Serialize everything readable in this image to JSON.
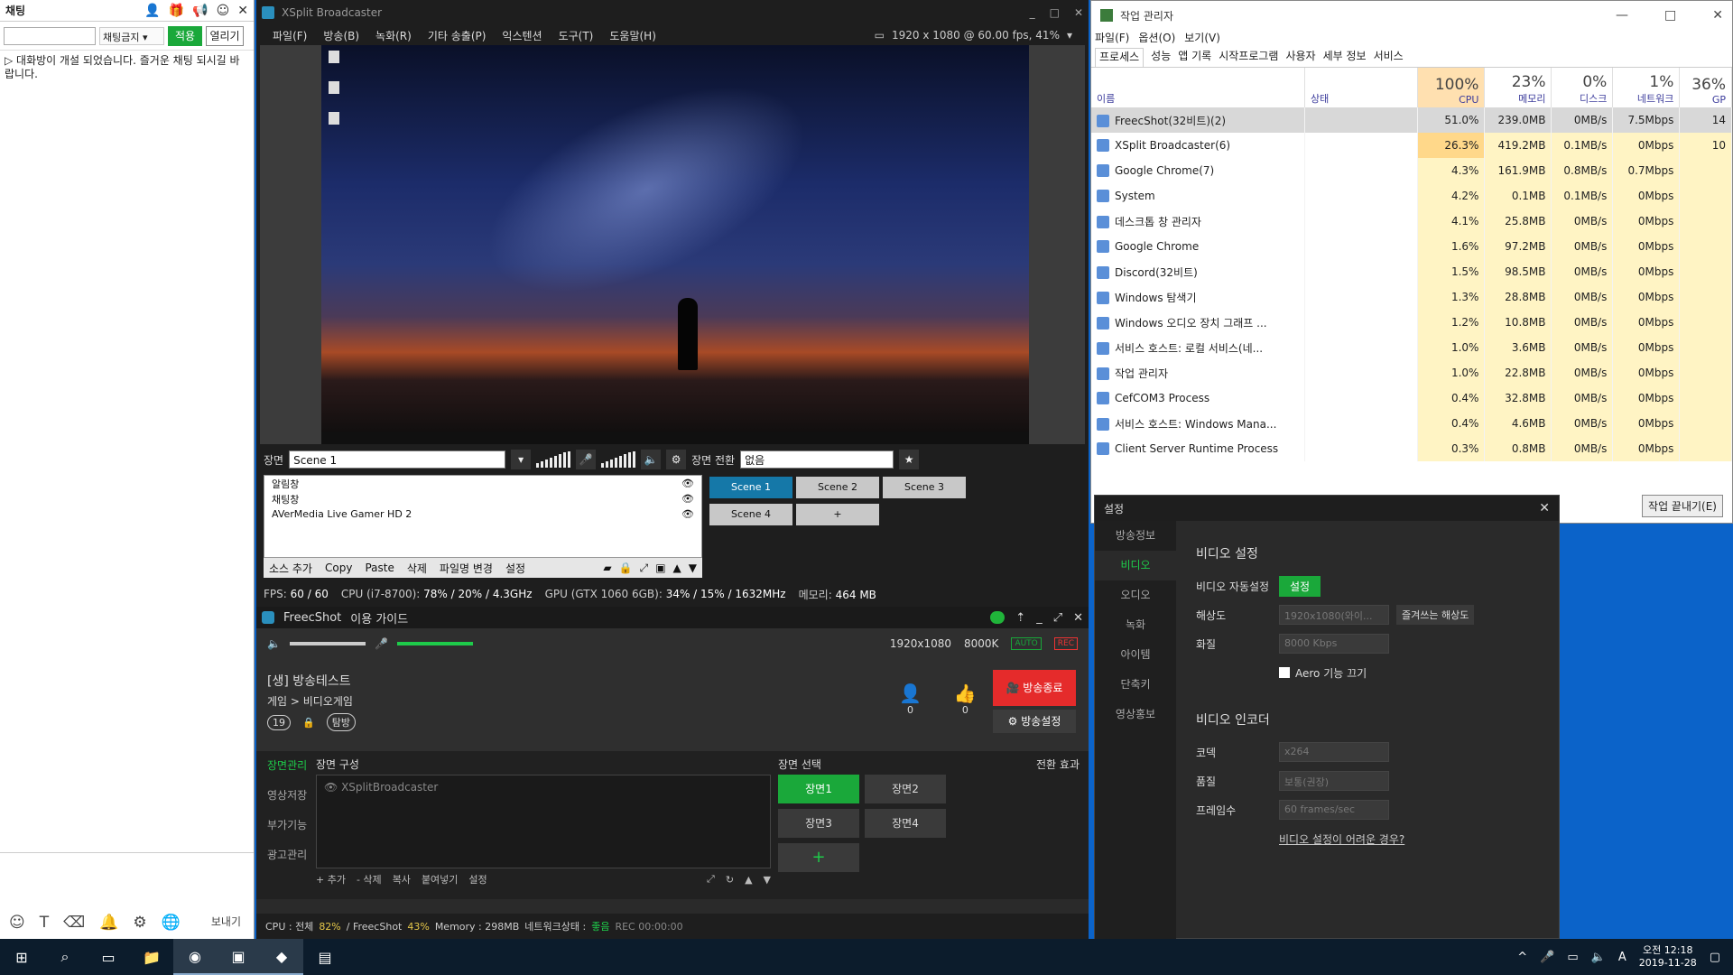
{
  "chat": {
    "title": "채팅",
    "filter_select": "채팅금지",
    "apply_label": "적용",
    "open_label": "열리기",
    "message": "▷ 대화방이 개설 되었습니다. 즐거운 채팅 되시길 바랍니다.",
    "send_label": "보내기"
  },
  "xsplit": {
    "title": "XSplit Broadcaster",
    "menu": [
      "파일(F)",
      "방송(B)",
      "녹화(R)",
      "기타 송출(P)",
      "익스텐션",
      "도구(T)",
      "도움말(H)"
    ],
    "resolution": "1920 x 1080 @ 60.00 fps, 41%",
    "scene_label": "장면",
    "scene_name": "Scene 1",
    "transition_label": "장면 전환",
    "transition_value": "없음",
    "sources": [
      "알림창",
      "채팅창",
      "AVerMedia Live Gamer HD 2"
    ],
    "source_actions": [
      "소스 추가",
      "Copy",
      "Paste",
      "삭제",
      "파일명 변경",
      "설정"
    ],
    "scenes": [
      "Scene 1",
      "Scene 2",
      "Scene 3",
      "Scene 4",
      "+"
    ],
    "status": {
      "fps_label": "FPS:",
      "fps": "60 / 60",
      "cpu_label": "CPU (i7-8700):",
      "cpu": "78% / 20% / 4.3GHz",
      "gpu_label": "GPU (GTX 1060 6GB):",
      "gpu": "34% / 15% / 1632MHz",
      "mem_label": "메모리:",
      "mem": "464 MB"
    }
  },
  "freecshot": {
    "title": "FreecShot",
    "guide": "이용 가이드",
    "resolution": "1920x1080",
    "bitrate": "8000K",
    "auto": "AUTO",
    "rec": "REC",
    "broadcast_title": "[생] 방송테스트",
    "category": "게임 > 비디오게임",
    "age_badge": "19",
    "tag": "탐방",
    "viewers": "0",
    "likes": "0",
    "end_label": "방송종료",
    "settings_label": "방송설정",
    "side": [
      "장면관리",
      "영상저장",
      "부가기능",
      "광고관리"
    ],
    "compose_title": "장면 구성",
    "compose_item": "XSplitBroadcaster",
    "compose_actions": [
      "+ 추가",
      "- 삭제",
      "복사",
      "붙여넣기",
      "설정"
    ],
    "pick_title": "장면 선택",
    "transition": "전환 효과",
    "scenes": [
      "장면1",
      "장면2",
      "장면3",
      "장면4"
    ],
    "status": {
      "cpu_label": "CPU : 전체",
      "cpu_total": "82%",
      "freecshot_label": "/ FreecShot",
      "freecshot_cpu": "43%",
      "memory": "Memory : 298MB",
      "net_label": "네트워크상태 :",
      "net": "좋음",
      "rec": "REC 00:00:00"
    }
  },
  "taskmgr": {
    "title": "작업 관리자",
    "menu": [
      "파일(F)",
      "옵션(O)",
      "보기(V)"
    ],
    "tabs": [
      "프로세스",
      "성능",
      "앱 기록",
      "시작프로그램",
      "사용자",
      "세부 정보",
      "서비스"
    ],
    "headers": {
      "name": "이름",
      "status": "상태",
      "cpu_pct": "100%",
      "cpu": "CPU",
      "mem_pct": "23%",
      "mem": "메모리",
      "disk_pct": "0%",
      "disk": "디스크",
      "net_pct": "1%",
      "net": "네트워크",
      "gpu_pct": "36%",
      "gpu": "GP"
    },
    "rows": [
      {
        "name": "FreecShot(32비트)(2)",
        "cpu": "51.0%",
        "mem": "239.0MB",
        "disk": "0MB/s",
        "net": "7.5Mbps",
        "gpu": "14"
      },
      {
        "name": "XSplit Broadcaster(6)",
        "cpu": "26.3%",
        "mem": "419.2MB",
        "disk": "0.1MB/s",
        "net": "0Mbps",
        "gpu": "10"
      },
      {
        "name": "Google Chrome(7)",
        "cpu": "4.3%",
        "mem": "161.9MB",
        "disk": "0.8MB/s",
        "net": "0.7Mbps",
        "gpu": ""
      },
      {
        "name": "System",
        "cpu": "4.2%",
        "mem": "0.1MB",
        "disk": "0.1MB/s",
        "net": "0Mbps",
        "gpu": ""
      },
      {
        "name": "데스크톱 창 관리자",
        "cpu": "4.1%",
        "mem": "25.8MB",
        "disk": "0MB/s",
        "net": "0Mbps",
        "gpu": ""
      },
      {
        "name": "Google Chrome",
        "cpu": "1.6%",
        "mem": "97.2MB",
        "disk": "0MB/s",
        "net": "0Mbps",
        "gpu": ""
      },
      {
        "name": "Discord(32비트)",
        "cpu": "1.5%",
        "mem": "98.5MB",
        "disk": "0MB/s",
        "net": "0Mbps",
        "gpu": ""
      },
      {
        "name": "Windows 탐색기",
        "cpu": "1.3%",
        "mem": "28.8MB",
        "disk": "0MB/s",
        "net": "0Mbps",
        "gpu": ""
      },
      {
        "name": "Windows 오디오 장치 그래프 ...",
        "cpu": "1.2%",
        "mem": "10.8MB",
        "disk": "0MB/s",
        "net": "0Mbps",
        "gpu": ""
      },
      {
        "name": "서비스 호스트: 로컬 서비스(네...",
        "cpu": "1.0%",
        "mem": "3.6MB",
        "disk": "0MB/s",
        "net": "0Mbps",
        "gpu": ""
      },
      {
        "name": "작업 관리자",
        "cpu": "1.0%",
        "mem": "22.8MB",
        "disk": "0MB/s",
        "net": "0Mbps",
        "gpu": ""
      },
      {
        "name": "CefCOM3 Process",
        "cpu": "0.4%",
        "mem": "32.8MB",
        "disk": "0MB/s",
        "net": "0Mbps",
        "gpu": ""
      },
      {
        "name": "서비스 호스트: Windows Mana...",
        "cpu": "0.4%",
        "mem": "4.6MB",
        "disk": "0MB/s",
        "net": "0Mbps",
        "gpu": ""
      },
      {
        "name": "Client Server Runtime Process",
        "cpu": "0.3%",
        "mem": "0.8MB",
        "disk": "0MB/s",
        "net": "0Mbps",
        "gpu": ""
      }
    ],
    "end_task": "작업 끝내기(E)"
  },
  "settings": {
    "title": "설정",
    "side": [
      "방송정보",
      "비디오",
      "오디오",
      "녹화",
      "아이템",
      "단축키",
      "영상홍보"
    ],
    "video_title": "비디오 설정",
    "auto_label": "비디오 자동설정",
    "auto_btn": "설정",
    "res_label": "해상도",
    "res_value": "1920x1080(와이...",
    "fav_res": "즐겨쓰는 해상도",
    "quality_label": "화질",
    "quality_value": "8000 Kbps",
    "aero": "Aero 기능 끄기",
    "encoder_title": "비디오 인코더",
    "codec_label": "코덱",
    "codec_value": "x264",
    "preset_label": "품질",
    "preset_value": "보통(권장)",
    "fps_label": "프레임수",
    "fps_value": "60 frames/sec",
    "help_link": "비디오 설정이 어려운 경우?"
  },
  "taskbar": {
    "time": "오전 12:18",
    "date": "2019-11-28",
    "ime": "A"
  }
}
